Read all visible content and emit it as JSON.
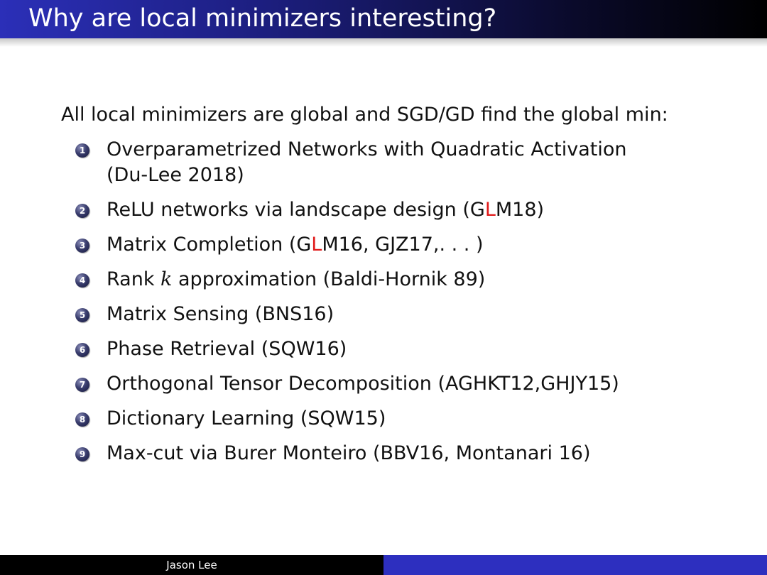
{
  "slide": {
    "title": "Why are local minimizers interesting?",
    "intro": "All local minimizers are global and SGD/GD find the global min:",
    "items": [
      {
        "num": "1",
        "line1": "Overparametrized Networks with Quadratic Activation",
        "line2": "(Du-Lee 2018)"
      },
      {
        "num": "2",
        "pre": "ReLU networks via landscape design (G",
        "red": "L",
        "post": "M18)"
      },
      {
        "num": "3",
        "pre": "Matrix Completion (G",
        "red": "L",
        "post": "M16, GJZ17,. . . )"
      },
      {
        "num": "4",
        "pre": "Rank ",
        "var": "k",
        "post": " approximation (Baldi-Hornik 89)"
      },
      {
        "num": "5",
        "text": "Matrix Sensing (BNS16)"
      },
      {
        "num": "6",
        "text": "Phase Retrieval (SQW16)"
      },
      {
        "num": "7",
        "text": "Orthogonal Tensor Decomposition (AGHKT12,GHJY15)"
      },
      {
        "num": "8",
        "text": "Dictionary Learning (SQW15)"
      },
      {
        "num": "9",
        "text": "Max-cut via Burer Monteiro (BBV16, Montanari 16)"
      }
    ],
    "footer_author": "Jason Lee"
  },
  "colors": {
    "title_bar_start": "#2b2fb8",
    "title_bar_end": "#000000",
    "highlight_red": "#e01a1a",
    "footer_blue": "#2d2fbf",
    "footer_black": "#000000"
  },
  "icons": {
    "item_bullet": "numbered-ball-icon"
  }
}
